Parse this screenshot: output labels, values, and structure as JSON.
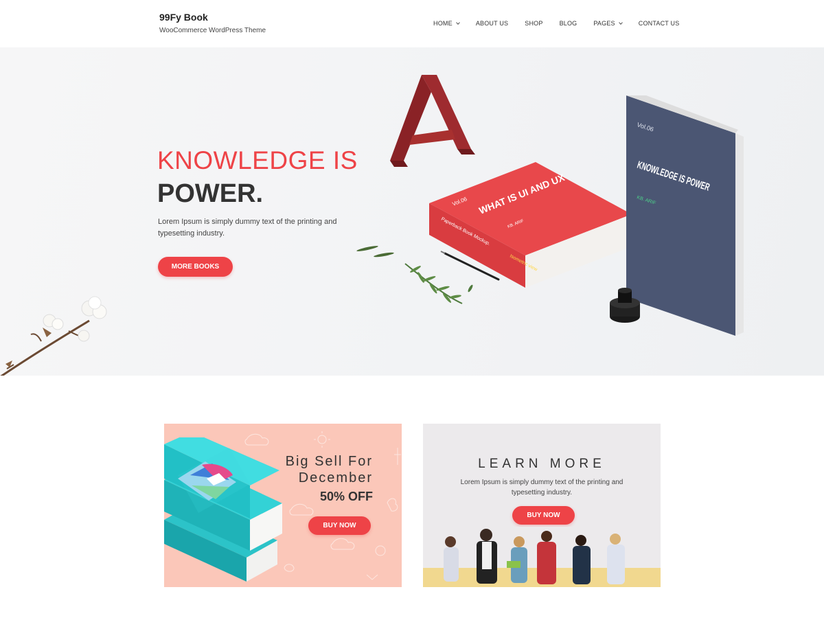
{
  "header": {
    "site_title": "99Fy Book",
    "tagline": "WooCommerce WordPress Theme",
    "nav": [
      {
        "label": "HOME",
        "has_dropdown": true
      },
      {
        "label": "ABOUT US",
        "has_dropdown": false
      },
      {
        "label": "SHOP",
        "has_dropdown": false
      },
      {
        "label": "BLOG",
        "has_dropdown": false
      },
      {
        "label": "PAGES",
        "has_dropdown": true
      },
      {
        "label": "CONTACT US",
        "has_dropdown": false
      }
    ]
  },
  "hero": {
    "headline_line1": "KNOWLEDGE IS",
    "headline_line2": "POWER.",
    "description": "Lorem Ipsum is simply dummy text of the printing and typesetting industry.",
    "button_label": "MORE BOOKS",
    "red_book": {
      "vol": "Vol.06",
      "title": "WHAT IS UI AND UX",
      "author": "KB. ARIF",
      "spine": "Paperback Book Mockup.",
      "tag": "Isometric view"
    },
    "blue_book": {
      "vol": "Vol.06",
      "title": "KNOWLEDGE IS POWER",
      "author": "KB. ARIF"
    }
  },
  "promo_left": {
    "line1": "Big Sell For",
    "line2": "December",
    "line3": "50% OFF",
    "button_label": "BUY NOW"
  },
  "promo_right": {
    "title": "LEARN MORE",
    "description": "Lorem Ipsum is simply dummy text of the printing and typesetting industry.",
    "button_label": "BUY NOW"
  },
  "colors": {
    "accent": "#ee4347",
    "promo_left_bg": "#fbc7b9",
    "promo_right_bg": "#eceaec",
    "dark_text": "#333333"
  }
}
